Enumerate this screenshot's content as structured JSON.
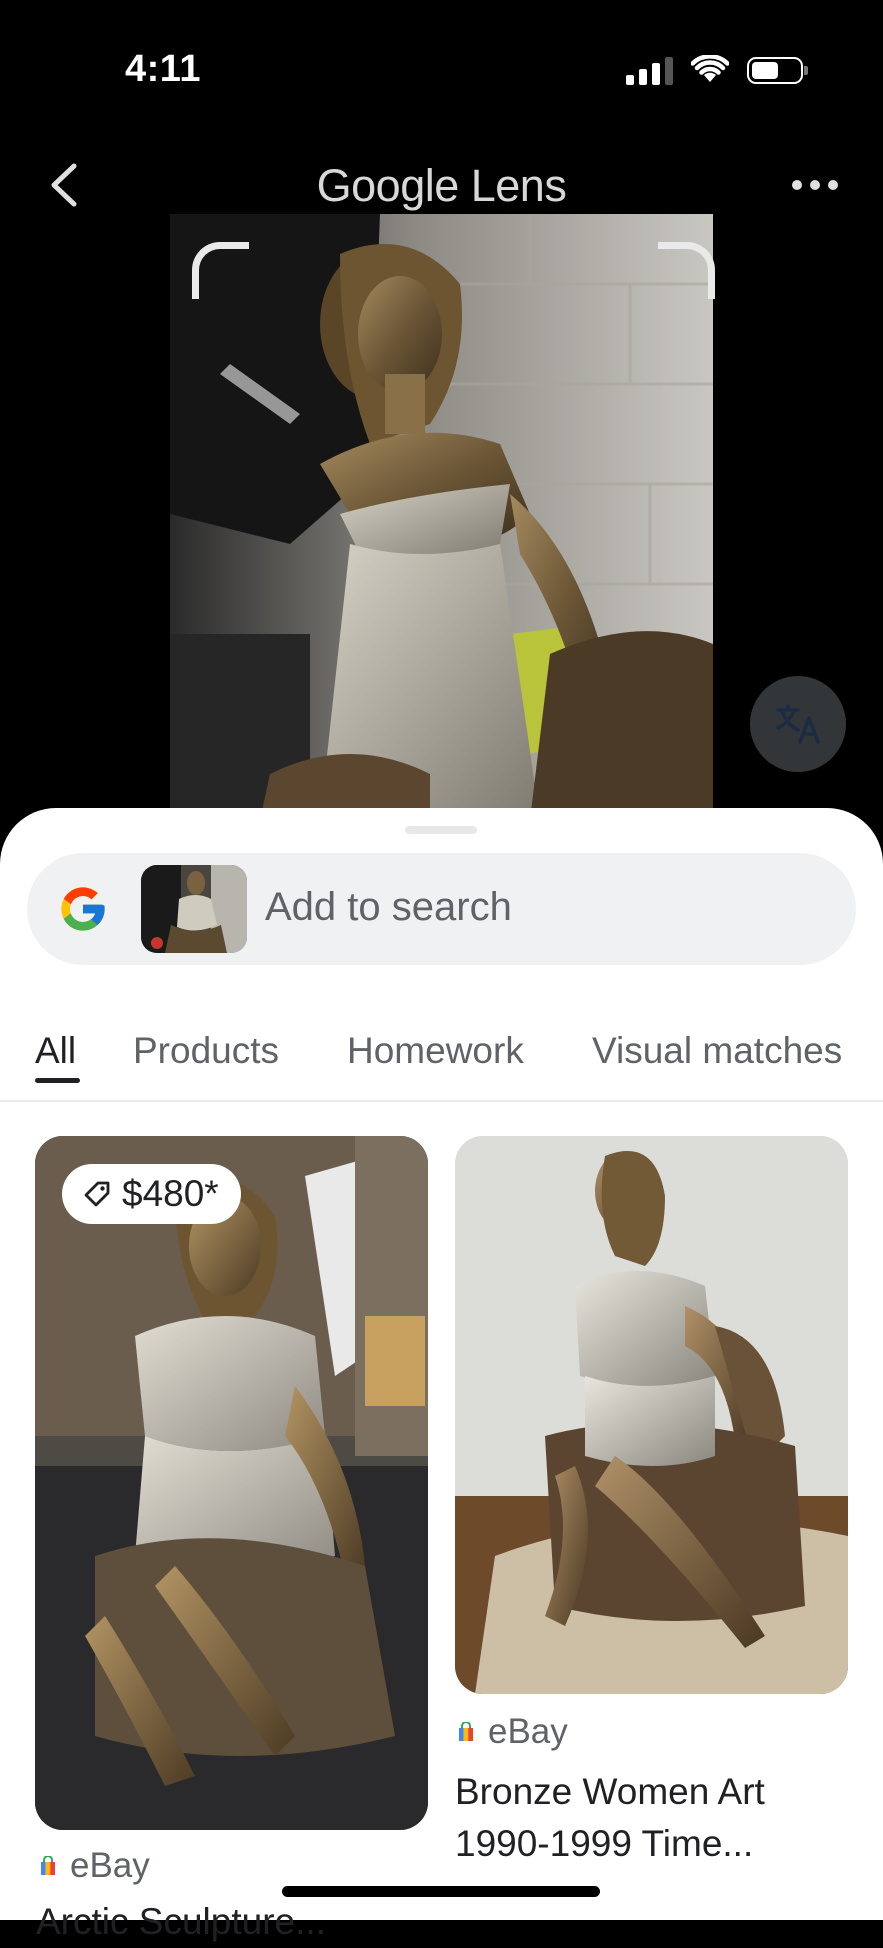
{
  "status_bar": {
    "time": "4:11"
  },
  "header": {
    "title": "Google Lens"
  },
  "search": {
    "placeholder": "Add to search"
  },
  "tabs": [
    {
      "label": "All",
      "active": true
    },
    {
      "label": "Products",
      "active": false
    },
    {
      "label": "Homework",
      "active": false
    },
    {
      "label": "Visual matches",
      "active": false
    }
  ],
  "results": [
    {
      "price": "$480*",
      "source": "eBay",
      "title": "Arctic Sculpture..."
    },
    {
      "source": "eBay",
      "title_line1": "Bronze Women Art",
      "title_line2": "1990-1999 Time..."
    }
  ],
  "icons": {
    "back": "chevron-left-icon",
    "more": "more-horizontal-icon",
    "translate": "translate-icon",
    "google": "google-g-icon",
    "price_tag": "tag-icon",
    "shopping": "shopping-bag-icon"
  },
  "colors": {
    "accent": "#202124",
    "sheet": "#ffffff",
    "pill": "#f0f1f3"
  }
}
